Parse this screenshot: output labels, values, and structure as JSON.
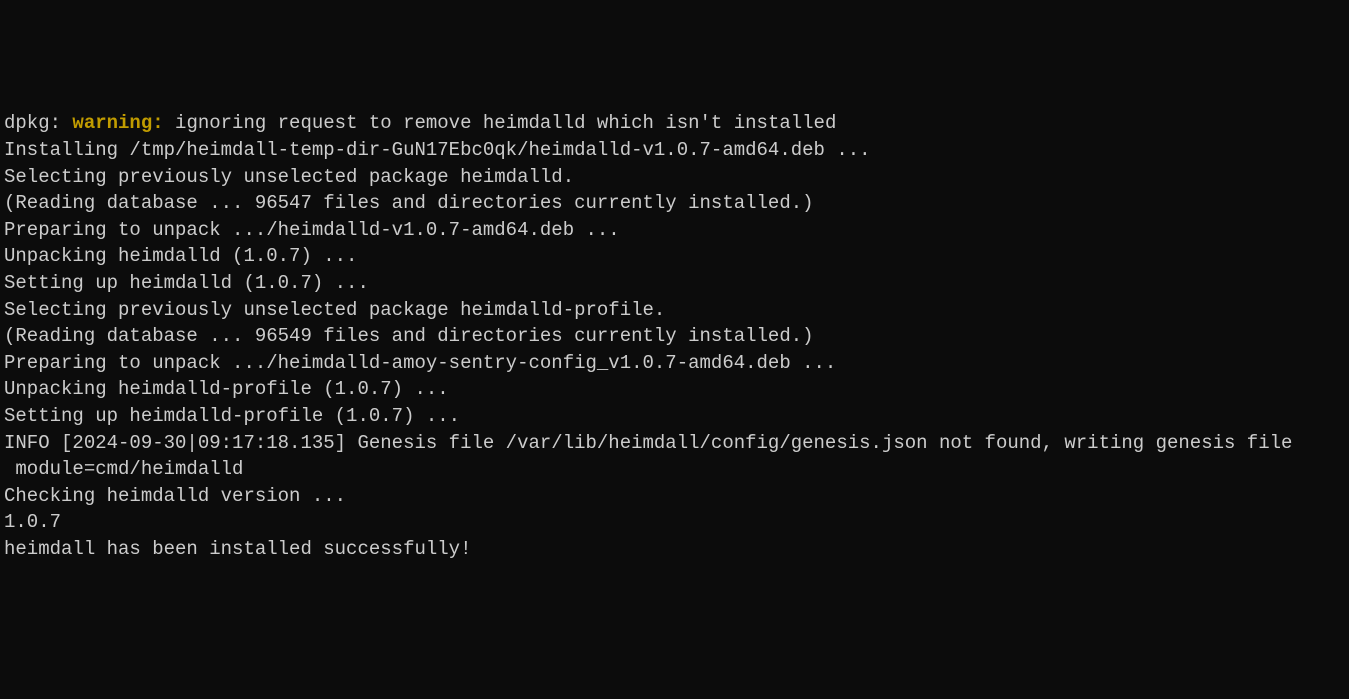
{
  "lines": {
    "l0_prefix": "dpkg: ",
    "l0_warning": "warning:",
    "l0_suffix": " ignoring request to remove heimdalld which isn't installed",
    "l1": "Installing /tmp/heimdall-temp-dir-GuN17Ebc0qk/heimdalld-v1.0.7-amd64.deb ...",
    "l2": "Selecting previously unselected package heimdalld.",
    "l3": "(Reading database ... 96547 files and directories currently installed.)",
    "l4": "Preparing to unpack .../heimdalld-v1.0.7-amd64.deb ...",
    "l5": "Unpacking heimdalld (1.0.7) ...",
    "l6": "Setting up heimdalld (1.0.7) ...",
    "l7": "Selecting previously unselected package heimdalld-profile.",
    "l8": "(Reading database ... 96549 files and directories currently installed.)",
    "l9": "Preparing to unpack .../heimdalld-amoy-sentry-config_v1.0.7-amd64.deb ...",
    "l10": "Unpacking heimdalld-profile (1.0.7) ...",
    "l11": "Setting up heimdalld-profile (1.0.7) ...",
    "l12": "INFO [2024-09-30|09:17:18.135] Genesis file /var/lib/heimdall/config/genesis.json not found, writing genesis file",
    "l13": " module=cmd/heimdalld",
    "l14": "Checking heimdalld version ...",
    "l15": "1.0.7",
    "l16": "heimdall has been installed successfully!"
  }
}
